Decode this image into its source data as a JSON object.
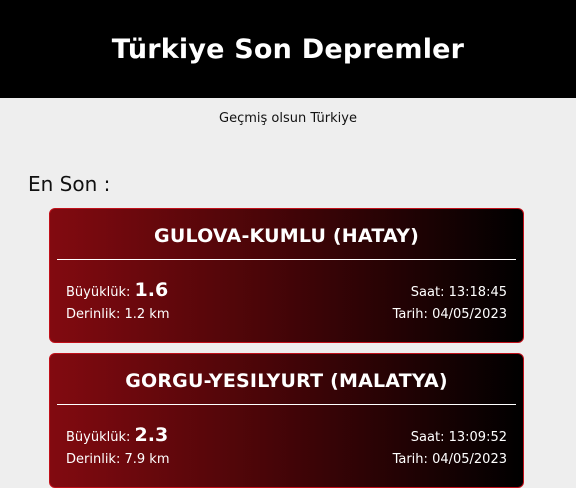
{
  "header": {
    "title": "Türkiye Son Depremler"
  },
  "subtitle": "Geçmiş olsun Türkiye",
  "latest": {
    "heading": "En Son :",
    "quakes": [
      {
        "location": "GULOVA-KUMLU (HATAY)",
        "magnitude_label": "Büyüklük:",
        "magnitude": "1.6",
        "depth_label": "Derinlik:",
        "depth": "1.2 km",
        "time_label": "Saat:",
        "time": "13:18:45",
        "date_label": "Tarih:",
        "date": "04/05/2023"
      },
      {
        "location": "GORGU-YESILYURT (MALATYA)",
        "magnitude_label": "Büyüklük:",
        "magnitude": "2.3",
        "depth_label": "Derinlik:",
        "depth": "7.9 km",
        "time_label": "Saat:",
        "time": "13:09:52",
        "date_label": "Tarih:",
        "date": "04/05/2023"
      }
    ]
  },
  "colors": {
    "header_bg": "#000000",
    "page_bg": "#eeeeee",
    "card_gradient_start": "#820a10",
    "card_gradient_end": "#000000",
    "card_border": "#c0101a"
  }
}
